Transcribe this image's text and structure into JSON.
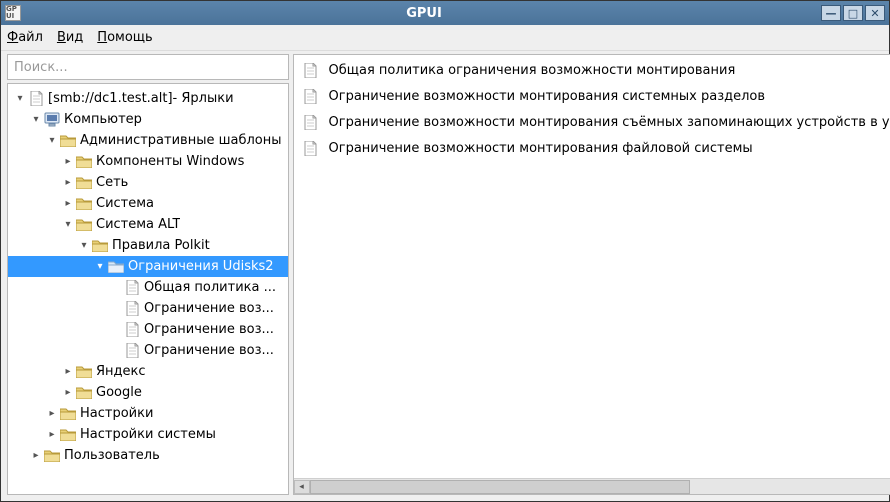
{
  "app": {
    "title": "GPUI",
    "icon_label": "GP\nUI"
  },
  "menu": {
    "file": {
      "text": "Файл",
      "ul_index": 0
    },
    "view": {
      "text": "Вид",
      "ul_index": 0
    },
    "help": {
      "text": "Помощь",
      "ul_index": 0
    }
  },
  "search": {
    "placeholder": "Поиск..."
  },
  "tree": {
    "root": {
      "label": "[smb://dc1.test.alt]- Ярлыки"
    },
    "computer": {
      "label": "Компьютер"
    },
    "admin_templates": {
      "label": "Административные шаблоны"
    },
    "windows_components": {
      "label": "Компоненты Windows"
    },
    "network": {
      "label": "Сеть"
    },
    "system": {
      "label": "Система"
    },
    "system_alt": {
      "label": "Система ALT"
    },
    "polkit_rules": {
      "label": "Правила Polkit"
    },
    "udisks2": {
      "label": "Ограничения Udisks2"
    },
    "doc1": {
      "label": "Общая политика ..."
    },
    "doc2": {
      "label": "Ограничение воз..."
    },
    "doc3": {
      "label": "Ограничение воз..."
    },
    "doc4": {
      "label": "Ограничение воз..."
    },
    "yandex": {
      "label": "Яндекс"
    },
    "google": {
      "label": "Google"
    },
    "settings": {
      "label": "Настройки"
    },
    "system_settings": {
      "label": "Настройки системы"
    },
    "user": {
      "label": "Пользователь"
    }
  },
  "list": {
    "items": [
      {
        "label": "Общая политика ограничения возможности монтирования"
      },
      {
        "label": "Ограничение возможности монтирования системных разделов"
      },
      {
        "label": "Ограничение возможности монтирования съёмных запоминающих устройств в удалённом сеансе"
      },
      {
        "label": "Ограничение возможности монтирования файловой системы"
      }
    ]
  }
}
